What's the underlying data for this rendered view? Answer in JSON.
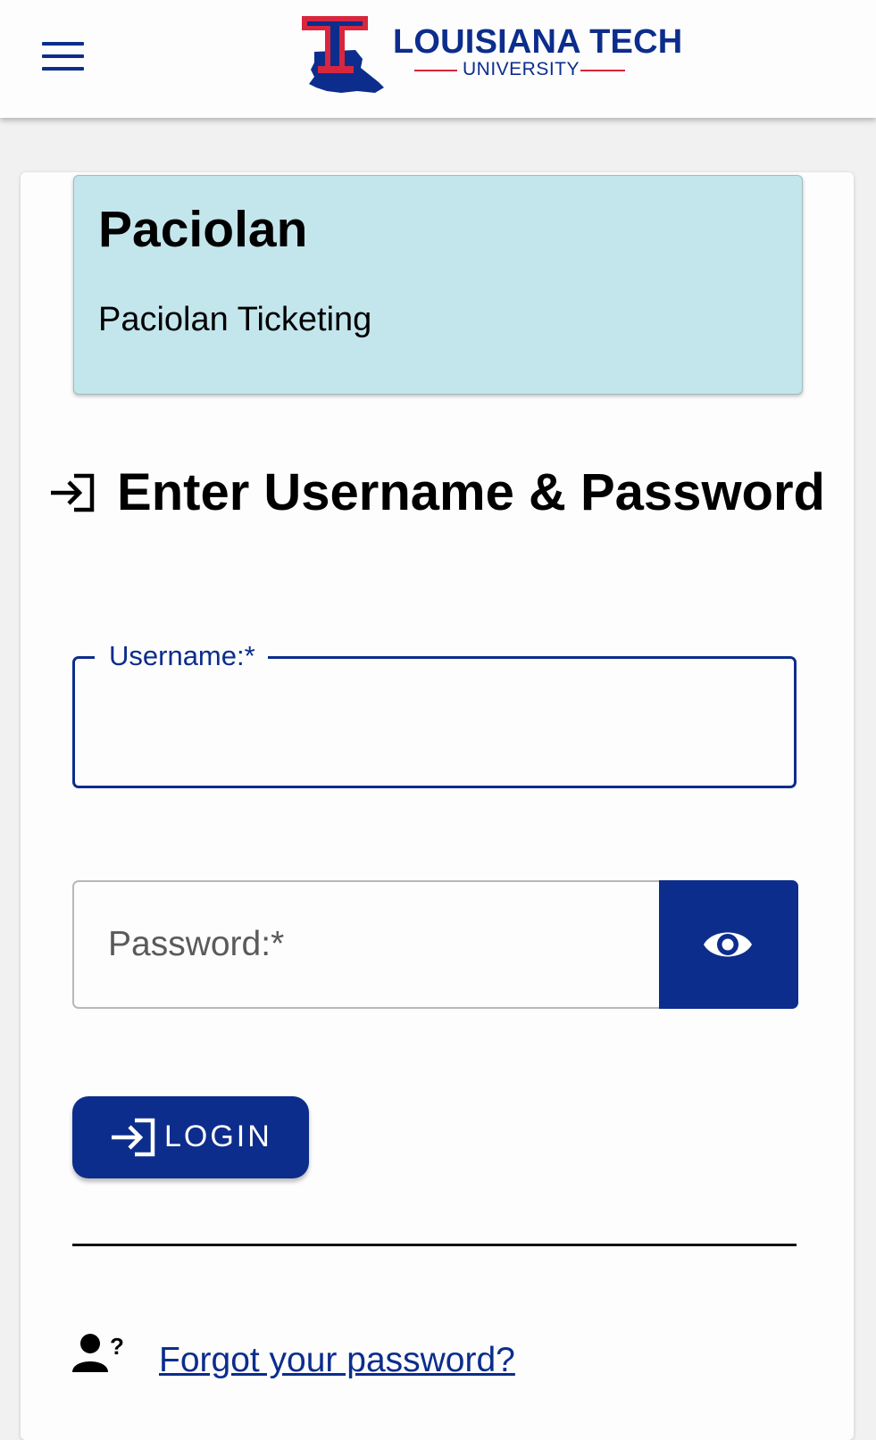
{
  "header": {
    "menu_icon": "hamburger-menu-icon",
    "logo": {
      "title": "LOUISIANA TECH",
      "subtitle": "UNIVERSITY",
      "brand_blue": "#0c2d8c",
      "brand_red": "#d7263d"
    }
  },
  "app_box": {
    "title": "Paciolan",
    "subtitle": "Paciolan Ticketing",
    "background": "#c3e6ec"
  },
  "login_form": {
    "heading_icon": "login-arrow-icon",
    "heading": "Enter Username & Password",
    "username": {
      "label": "Username:*",
      "value": ""
    },
    "password": {
      "placeholder": "Password:*",
      "value": "",
      "toggle_icon": "eye-icon"
    },
    "login_button": {
      "icon": "login-arrow-icon",
      "label": "LOGIN"
    }
  },
  "forgot": {
    "icon": "user-question-icon",
    "label": "Forgot your password?"
  }
}
